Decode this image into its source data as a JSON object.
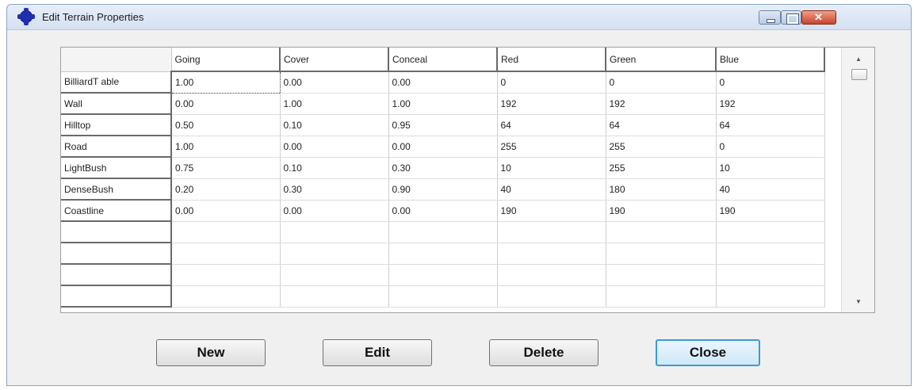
{
  "window": {
    "title": "Edit Terrain Properties",
    "controls": [
      "minimize-icon",
      "maximize-icon",
      "close-icon"
    ]
  },
  "grid": {
    "columns": [
      "Going",
      "Cover",
      "Conceal",
      "Red",
      "Green",
      "Blue"
    ],
    "rows": [
      {
        "name": "BilliardT able",
        "values": [
          "1.00",
          "0.00",
          "0.00",
          "0",
          "0",
          "0"
        ]
      },
      {
        "name": "Wall",
        "values": [
          "0.00",
          "1.00",
          "1.00",
          "192",
          "192",
          "192"
        ]
      },
      {
        "name": "Hilltop",
        "values": [
          "0.50",
          "0.10",
          "0.95",
          "64",
          "64",
          "64"
        ]
      },
      {
        "name": "Road",
        "values": [
          "1.00",
          "0.00",
          "0.00",
          "255",
          "255",
          "0"
        ]
      },
      {
        "name": "LightBush",
        "values": [
          "0.75",
          "0.10",
          "0.30",
          "10",
          "255",
          "10"
        ]
      },
      {
        "name": "DenseBush",
        "values": [
          "0.20",
          "0.30",
          "0.90",
          "40",
          "180",
          "40"
        ]
      },
      {
        "name": "Coastline",
        "values": [
          "0.00",
          "0.00",
          "0.00",
          "190",
          "190",
          "190"
        ]
      }
    ],
    "empty_rows": 4,
    "selected_cell": "row 0, Going"
  },
  "buttons": {
    "new": "New",
    "edit": "Edit",
    "delete": "Delete",
    "close": "Close"
  },
  "colors": {
    "titlebar": "#d4e1f2",
    "close_button": "#c7432b",
    "default_button_border": "#3c9ad6"
  }
}
